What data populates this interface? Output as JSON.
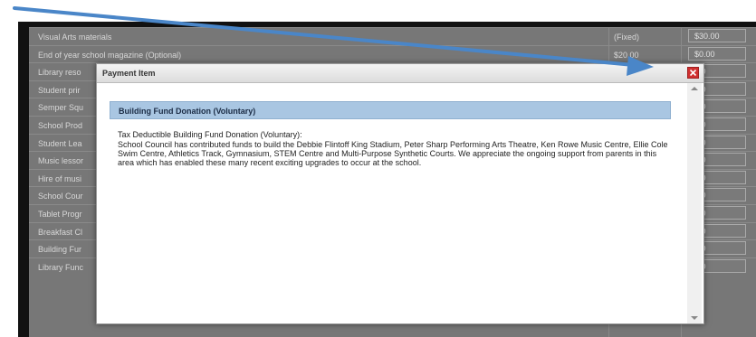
{
  "background": {
    "rows": [
      {
        "name": "Visual Arts materials",
        "type": "(Fixed)",
        "amount": "$30.00"
      },
      {
        "name": "End of year school magazine (Optional)",
        "type": "$20.00",
        "amount": "$0.00"
      },
      {
        "name": "Library reso",
        "type": "",
        "amount": ".00"
      },
      {
        "name": "Student prir",
        "type": "",
        "amount": ".00"
      },
      {
        "name": "Semper Squ",
        "type": "",
        "amount": ".00"
      },
      {
        "name": "School Prod",
        "type": "",
        "amount": ".00"
      },
      {
        "name": "Student Lea",
        "type": "",
        "amount": ".00"
      },
      {
        "name": "Music lessor",
        "type": "",
        "amount": ".00"
      },
      {
        "name": "Hire of musi",
        "type": "",
        "amount": ".00"
      },
      {
        "name": "School Cour",
        "type": "",
        "amount": ".00"
      },
      {
        "name": "Tablet Progr",
        "type": "",
        "amount": ".00"
      },
      {
        "name": "Breakfast Cl",
        "type": "",
        "amount": ".00"
      },
      {
        "name": "Building Fur",
        "type": "",
        "amount": ".00"
      },
      {
        "name": "Library Func",
        "type": "",
        "amount": ".00"
      }
    ]
  },
  "modal": {
    "title": "Payment Item",
    "section_heading": "Building Fund Donation (Voluntary)",
    "description_title": "Tax Deductible Building Fund Donation (Voluntary):",
    "description": "School Council has contributed funds to build the Debbie Flintoff King Stadium, Peter Sharp Performing Arts Theatre, Ken Rowe Music Centre, Ellie Cole Swim Centre, Athletics Track, Gymnasium, STEM Centre and Multi-Purpose Synthetic Courts. We appreciate the ongoing support from parents in this area which has enabled these many recent exciting upgrades to occur at the school."
  },
  "colors": {
    "accent_arrow": "#4a86c8",
    "close_button": "#d03030",
    "section_heading_bg": "#a9c6e2"
  },
  "icons": {
    "close": "close-icon",
    "scroll_up": "chevron-up-icon",
    "scroll_down": "chevron-down-icon",
    "annotation": "arrow-annotation"
  }
}
